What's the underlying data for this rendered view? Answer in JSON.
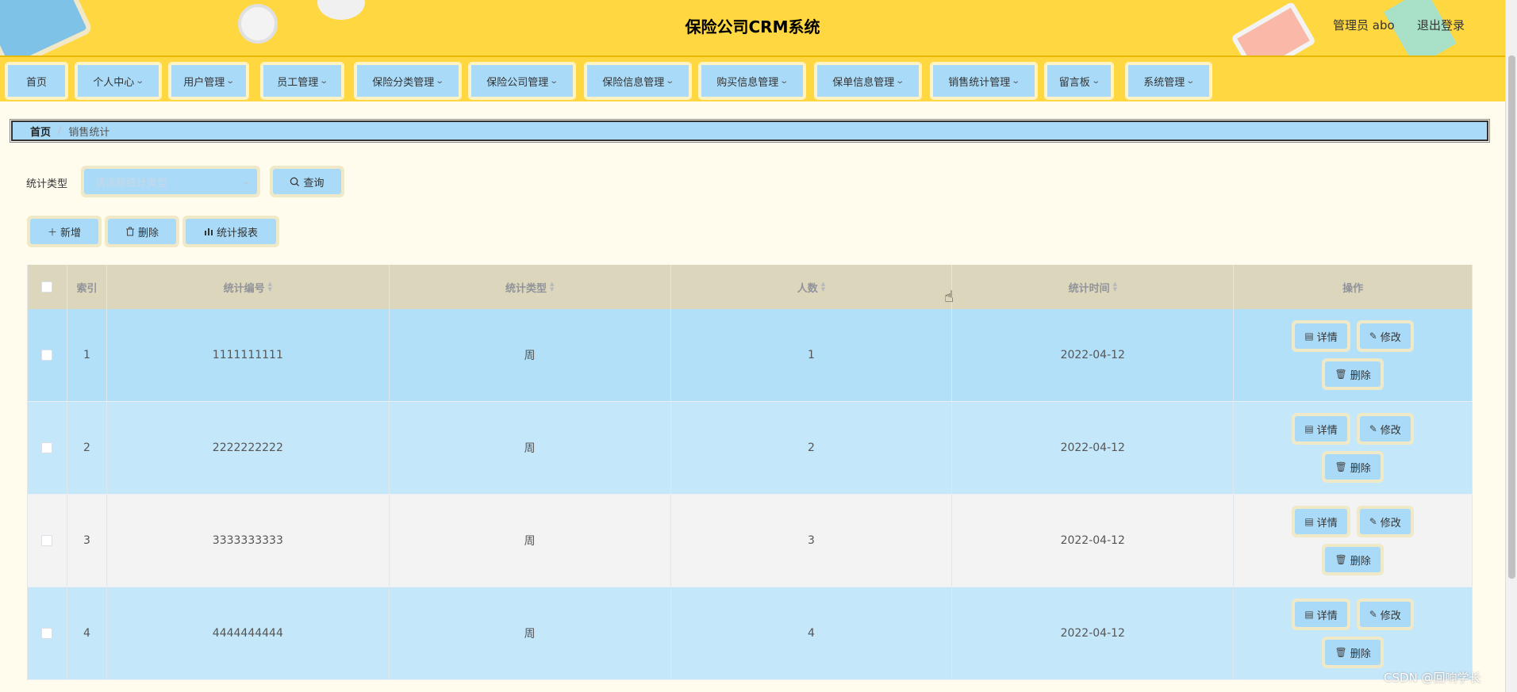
{
  "header": {
    "title": "保险公司CRM系统",
    "user": "管理员 abo",
    "logout": "退出登录"
  },
  "nav": {
    "items": [
      {
        "label": "首页"
      },
      {
        "label": "个人中心"
      },
      {
        "label": "用户管理"
      },
      {
        "label": "员工管理"
      },
      {
        "label": "保险分类管理"
      },
      {
        "label": "保险公司管理"
      },
      {
        "label": "保险信息管理"
      },
      {
        "label": "购买信息管理"
      },
      {
        "label": "保单信息管理"
      },
      {
        "label": "销售统计管理"
      },
      {
        "label": "留言板"
      },
      {
        "label": "系统管理"
      }
    ]
  },
  "breadcrumb": {
    "home": "首页",
    "separator": "/",
    "current": "销售统计"
  },
  "search": {
    "label": "统计类型",
    "placeholder": "请选择统计类型",
    "button": "查询"
  },
  "actions": {
    "add": "新增",
    "delete": "删除",
    "report": "统计报表"
  },
  "table": {
    "headers": [
      "索引",
      "统计编号",
      "统计类型",
      "人数",
      "统计时间",
      "操作"
    ],
    "rows": [
      {
        "index": "1",
        "code": "1111111111",
        "type": "周",
        "count": "1",
        "time": "2022-04-12"
      },
      {
        "index": "2",
        "code": "2222222222",
        "type": "周",
        "count": "2",
        "time": "2022-04-12"
      },
      {
        "index": "3",
        "code": "3333333333",
        "type": "周",
        "count": "3",
        "time": "2022-04-12"
      },
      {
        "index": "4",
        "code": "4444444444",
        "type": "周",
        "count": "4",
        "time": "2022-04-12"
      }
    ],
    "ops": {
      "detail": "详情",
      "edit": "修改",
      "delete": "删除"
    }
  },
  "watermark": "CSDN @回响学长",
  "colors": {
    "header": "#ffd740",
    "button": "#a9daf7",
    "row_blue": "#b3e0f9",
    "row_blue_light": "#c5e7fa",
    "row_grey": "#f3f3f3",
    "table_header": "#dcd6bd"
  }
}
